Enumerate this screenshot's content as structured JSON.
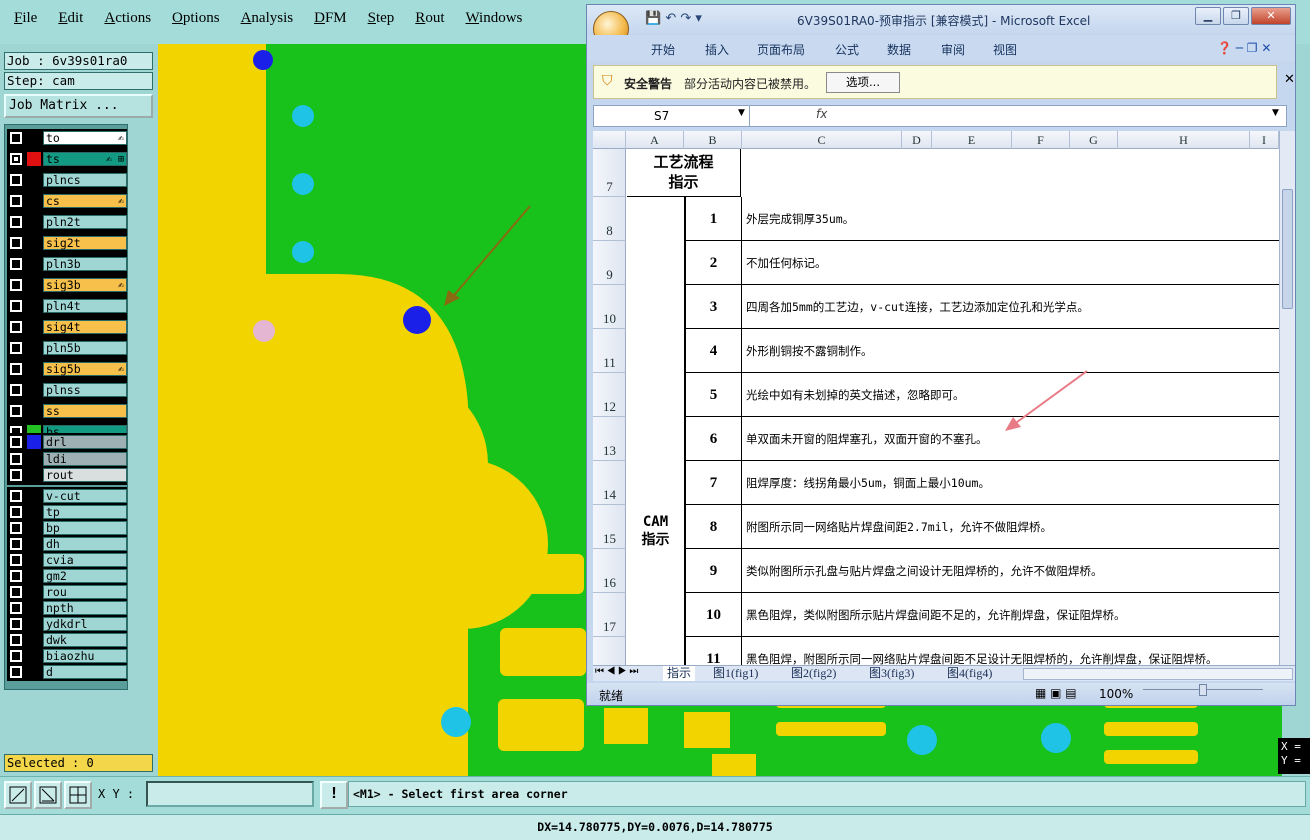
{
  "menu": [
    "File",
    "Edit",
    "Actions",
    "Options",
    "Analysis",
    "DFM",
    "Step",
    "Rout",
    "Windows"
  ],
  "job": "Job : 6v39s01ra0",
  "step": "Step: cam",
  "job_matrix": "Job Matrix ...",
  "layers": [
    {
      "name": "to",
      "color": "#ffffff",
      "swatch": "#000000",
      "checked": false,
      "mark": "✍"
    },
    {
      "name": "ts",
      "color": "#129a82",
      "swatch": "#e01010",
      "checked": true,
      "mark": "✍ ⊞"
    },
    {
      "name": "plncs",
      "color": "#9fd6d4",
      "swatch": "#000000",
      "checked": false,
      "mark": ""
    },
    {
      "name": "cs",
      "color": "#f6c04a",
      "swatch": "#000000",
      "checked": false,
      "mark": "✍"
    },
    {
      "name": "pln2t",
      "color": "#9fd6d4",
      "swatch": "#000000",
      "checked": false,
      "mark": ""
    },
    {
      "name": "sig2t",
      "color": "#f6c04a",
      "swatch": "#000000",
      "checked": false,
      "mark": ""
    },
    {
      "name": "pln3b",
      "color": "#9fd6d4",
      "swatch": "#000000",
      "checked": false,
      "mark": ""
    },
    {
      "name": "sig3b",
      "color": "#f6c04a",
      "swatch": "#000000",
      "checked": false,
      "mark": "✍"
    },
    {
      "name": "pln4t",
      "color": "#9fd6d4",
      "swatch": "#000000",
      "checked": false,
      "mark": ""
    },
    {
      "name": "sig4t",
      "color": "#f6c04a",
      "swatch": "#000000",
      "checked": false,
      "mark": ""
    },
    {
      "name": "pln5b",
      "color": "#9fd6d4",
      "swatch": "#000000",
      "checked": false,
      "mark": ""
    },
    {
      "name": "sig5b",
      "color": "#f6c04a",
      "swatch": "#000000",
      "checked": false,
      "mark": "✍"
    },
    {
      "name": "plnss",
      "color": "#9fd6d4",
      "swatch": "#000000",
      "checked": false,
      "mark": ""
    },
    {
      "name": "ss",
      "color": "#f6c04a",
      "swatch": "#000000",
      "checked": false,
      "mark": ""
    },
    {
      "name": "bs",
      "color": "#129a82",
      "swatch": "#22c022",
      "checked": false,
      "mark": ""
    },
    {
      "name": "drl",
      "color": "#9fb0b4",
      "swatch": "#1a20e8",
      "checked": false,
      "mark": ""
    },
    {
      "name": "ldi",
      "color": "#9fb0b4",
      "swatch": "#000000",
      "checked": false,
      "mark": ""
    },
    {
      "name": "rout",
      "color": "#d9dede",
      "swatch": "#000000",
      "checked": false,
      "mark": ""
    },
    {
      "name": "v-cut",
      "color": "#9fd6d4",
      "swatch": "#000000",
      "checked": false,
      "mark": ""
    },
    {
      "name": "tp",
      "color": "#9fd6d4",
      "swatch": "#000000",
      "checked": false,
      "mark": ""
    },
    {
      "name": "bp",
      "color": "#9fd6d4",
      "swatch": "#000000",
      "checked": false,
      "mark": ""
    },
    {
      "name": "dh",
      "color": "#9fd6d4",
      "swatch": "#000000",
      "checked": false,
      "mark": ""
    },
    {
      "name": "cvia",
      "color": "#9fd6d4",
      "swatch": "#000000",
      "checked": false,
      "mark": ""
    },
    {
      "name": "gm2",
      "color": "#9fd6d4",
      "swatch": "#000000",
      "checked": false,
      "mark": ""
    },
    {
      "name": "rou",
      "color": "#9fd6d4",
      "swatch": "#000000",
      "checked": false,
      "mark": ""
    },
    {
      "name": "npth",
      "color": "#9fd6d4",
      "swatch": "#000000",
      "checked": false,
      "mark": ""
    },
    {
      "name": "ydkdrl",
      "color": "#9fd6d4",
      "swatch": "#000000",
      "checked": false,
      "mark": ""
    },
    {
      "name": "dwk",
      "color": "#9fd6d4",
      "swatch": "#000000",
      "checked": false,
      "mark": ""
    },
    {
      "name": "biaozhu",
      "color": "#9fd6d4",
      "swatch": "#000000",
      "checked": false,
      "mark": ""
    },
    {
      "name": "d",
      "color": "#9fd6d4",
      "swatch": "#000000",
      "checked": false,
      "mark": ""
    }
  ],
  "selected": "Selected : 0",
  "xy_label": "X Y :",
  "xy_value": "",
  "prompt": "<M1> - Select first area corner",
  "status": "DX=14.780775,DY=0.0076,D=14.780775",
  "coord_x": "X =",
  "coord_y": "Y =",
  "colors": {
    "copper": "#f2d400",
    "laminate": "#18c21b",
    "drill": "#1a20e8",
    "via": "#1fc3e6",
    "arrow": "#8a6a12"
  },
  "excel": {
    "title": "6V39S01RA0-预审指示  [兼容模式] - Microsoft Excel",
    "tabs": [
      "开始",
      "插入",
      "页面布局",
      "公式",
      "数据",
      "审阅",
      "视图"
    ],
    "security_title": "安全警告",
    "security_msg": "部分活动内容已被禁用。",
    "options_btn": "选项...",
    "namebox": "S7",
    "fx": "fx",
    "columns": [
      "A",
      "B",
      "C",
      "D",
      "E",
      "F",
      "G",
      "H",
      "I"
    ],
    "header_row": {
      "row": "7",
      "label": "工艺流程\n指示"
    },
    "section_label": "CAM\n指示",
    "rows": [
      {
        "row": "8",
        "num": "1",
        "text": "外层完成铜厚35um。"
      },
      {
        "row": "9",
        "num": "2",
        "text": "不加任何标记。"
      },
      {
        "row": "10",
        "num": "3",
        "text": "四周各加5mm的工艺边，v-cut连接，工艺边添加定位孔和光学点。"
      },
      {
        "row": "11",
        "num": "4",
        "text": "外形削铜按不露铜制作。"
      },
      {
        "row": "12",
        "num": "5",
        "text": "光绘中如有未划掉的英文描述，忽略即可。"
      },
      {
        "row": "13",
        "num": "6",
        "text": "单双面未开窗的阻焊塞孔，双面开窗的不塞孔。"
      },
      {
        "row": "14",
        "num": "7",
        "text": "阻焊厚度：线拐角最小5um，铜面上最小10um。"
      },
      {
        "row": "15",
        "num": "8",
        "text": "附图所示同一网络贴片焊盘间距2.7mil，允许不做阻焊桥。"
      },
      {
        "row": "16",
        "num": "9",
        "text": "类似附图所示孔盘与贴片焊盘之间设计无阻焊桥的，允许不做阻焊桥。"
      },
      {
        "row": "17",
        "num": "10",
        "text": "黑色阻焊，类似附图所示贴片焊盘间距不足的，允许削焊盘，保证阻焊桥。"
      },
      {
        "row": "18",
        "num": "11",
        "text": "黑色阻焊，附图所示同一网络贴片焊盘间距不足设计无阻焊桥的，允许削焊盘，保证阻焊桥。"
      }
    ],
    "sheets": [
      "指示",
      "图1(fig1)",
      "图2(fig2)",
      "图3(fig3)",
      "图4(fig4)"
    ],
    "status_ready": "就绪",
    "zoom": "100%"
  }
}
